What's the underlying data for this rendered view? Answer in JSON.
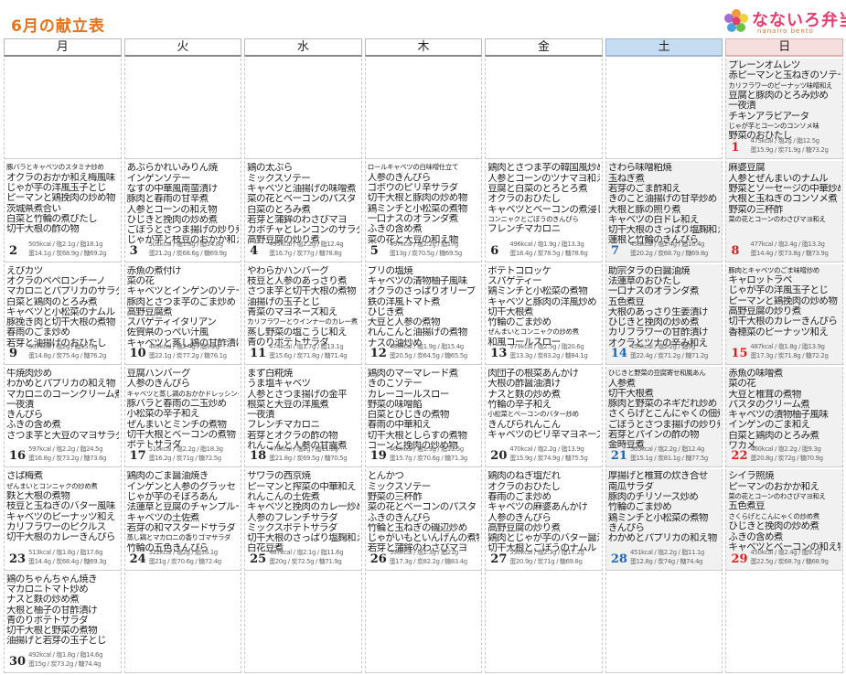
{
  "title": "6月の献立表",
  "logo": {
    "text": "なないろ弁当",
    "sub": "nanairo bento"
  },
  "weekdays": [
    "月",
    "火",
    "水",
    "木",
    "金",
    "土",
    "日"
  ],
  "calendar": [
    [
      null,
      null,
      null,
      null,
      null,
      null,
      {
        "day": "1",
        "menu": [
          "プレーンオムレツ",
          "赤ピーマンと玉ねぎのソテー",
          "カリフラワーのピーナッツ味噌和え",
          "豆腐と豚肉のとろみ炒め",
          "一夜漬",
          "チキンアラビアータ",
          "じゃが芋とコーンのコンソメ味",
          "野菜のおひたし"
        ],
        "nut1": "475kcal / 塩2g / 脂12.5g",
        "nut2": "蛋15.9g / 炭71.9g / 糖73.2g"
      }
    ],
    [
      {
        "day": "2",
        "menu": [
          "豚バラとキャベツのスタミナ炒め",
          "オクラのおかか和え梅風味",
          "じゃが芋の洋風玉子とじ",
          "ピーマンと鶏挽肉の炒め物",
          "茨城県煮合い",
          "白菜と竹輪の煮びたし",
          "切干大根の酢の物"
        ],
        "nut1": "505kcal / 塩2.1g / 脂18.1g",
        "nut2": "蛋14.1g / 炭68.9g / 糖69.2g"
      },
      {
        "day": "3",
        "menu": [
          "あぶらかれいみりん焼",
          "インゲンソテー",
          "なすの中華風南蛮漬け",
          "豚肉と春雨の甘辛煮",
          "人参とコーンの和え物",
          "ひじきと挽肉の炒め煮",
          "ごぼうとさつま揚げの炒り煮",
          "じゃが芋と枝豆のおかか和え"
        ],
        "nut1": "501kcal / 塩1.8g / 脂14.8g",
        "nut2": "蛋21.2g / 炭68.6g / 糖69.9g"
      },
      {
        "day": "4",
        "menu": [
          "鶏の太ぶら",
          "ミックスソテー",
          "キャベツと油揚げの味噌煮",
          "菜の花とベーコンのパスタ",
          "白菜のとろみ煮",
          "若芽と蒲鉾のわさびマヨ",
          "カボチャとレンコンのサラダ",
          "高野豆腐の炒り煮"
        ],
        "nut1": "495kcal / 塩2.2g / 脂12.4g",
        "nut2": "蛋16.7g / 炭77g / 糖78.8g"
      },
      {
        "day": "5",
        "menu": [
          "ロールキャベツの白味噌仕立て",
          "人参のきんぴら",
          "ゴボウのピリ辛サラダ",
          "切干大根と豚肉の炒め物",
          "鶏ミンチと小松菜の煮物",
          "一口ナスのオランダ煮",
          "ふきの含め煮",
          "菜の花と大豆の和え物"
        ],
        "nut1": "497kcal / 塩2.2g / 脂17g",
        "nut2": "蛋13g / 炭70.5g / 糖69.5g"
      },
      {
        "day": "6",
        "menu": [
          "鶏肉とさつま芋の韓国風炒め",
          "人参とコーンのツナマヨ和え",
          "豆腐と白菜のとろとろ煮",
          "オクラのおひたし",
          "キャベツとベーコンの煮浸し",
          "コンニャクとごぼうのきんぴら",
          "フレンチマカロニ"
        ],
        "nut1": "496kcal / 塩1.9g / 脂13.3g",
        "nut2": "蛋18.4g / 炭78.5g / 糖78.6g"
      },
      {
        "day": "7",
        "menu": [
          "さわら味噌粕焼",
          "玉ねぎ煮",
          "若芽のごま酢和え",
          "きのこと油揚げの甘辛炒め",
          "大根と豚の照り煮",
          "キャベツの白ドレ和え",
          "切干大根のさっぱり塩麹和え",
          "蓮根と竹輪のきんぴら"
        ],
        "nut1": "458kcal / 塩2.4g / 脂10.4g",
        "nut2": "蛋20.2g / 炭68.7g / 糖69.8g"
      },
      {
        "day": "8",
        "menu": [
          "麻婆豆腐",
          "人参とぜんまいのナムル",
          "野菜とソーセージの中華炒め",
          "大根と玉ねぎのコンソメ煮",
          "野菜の三杯酢",
          "菜の花とコーンのわさびマヨ和え"
        ],
        "nut1": "477kcal / 塩2.4g / 脂13.3g",
        "nut2": "蛋14.4g / 炭73.8g / 糖73.9g"
      }
    ],
    [
      {
        "day": "9",
        "menu": [
          "えびカツ",
          "オクラのペペロンチーノ",
          "マカロニとパプリカのサラダ",
          "白菜と鶏肉のとろみ煮",
          "キャベツと小松菜のナムル",
          "豚挽き肉と切干大根の煮物",
          "春雨のごま炒め",
          "若芽と油揚げのおひたし"
        ],
        "nut1": "507kcal / 塩2g / 脂15.3g",
        "nut2": "蛋14.8g / 炭75.4g / 糖76.2g"
      },
      {
        "day": "10",
        "menu": [
          "赤魚の煮付け",
          "菜の花",
          "キャベツとインゲンのソテー",
          "豚肉とさつま芋のごま炒め",
          "高野豆腐煮",
          "スパゲティイタリアン",
          "佐賀県のっぺい汁風",
          "キャベツと蒸し鶏の甘酢漬け"
        ],
        "nut1": "489kcal / 塩2.4g / 脂9.2g",
        "nut2": "蛋22.1g / 炭77.2g / 糖76.1g"
      },
      {
        "day": "11",
        "menu": [
          "やわらかハンバーグ",
          "枝豆と人参のあっさり煮",
          "さつま芋と切干大根の煮物",
          "油揚げの玉子とじ",
          "青菜のマヨネーズ和え",
          "カリフラワーとウインナーのカレー煮",
          "蒸し野菜の塩こうじ和え",
          "青のりポテトサラダ"
        ],
        "nut1": "474kcal / 塩1.7g / 脂13.1g",
        "nut2": "蛋15.6g / 炭71.8g / 糖71.4g"
      },
      {
        "day": "12",
        "menu": [
          "ブリの塩焼",
          "キャベツの清物柚子風味",
          "オクラのさっぱりオリーブ",
          "鉄の洋風トマト煮",
          "ひじき煮",
          "大豆と人参の煮物",
          "れんこんと油揚げの煮物",
          "ナスの油炒め"
        ],
        "nut1": "489kcal / 塩1.9g / 脂15.4g",
        "nut2": "蛋20.5g / 炭64.5g / 糖65.5g"
      },
      {
        "day": "13",
        "menu": [
          "ポテトコロッケ",
          "スパゲティー",
          "鶏ミンチと小松菜の煮物",
          "キャベツと豚肉の洋風炒め",
          "切干大根煮",
          "竹輪のごま炒め",
          "ぜんまいとコンニャクの炒め煮",
          "和風コールスロー"
        ],
        "nut1": "579kcal / 塩2.5g / 脂20.6g",
        "nut2": "蛋13.3g / 炭83.2g / 糖84.1g"
      },
      {
        "day": "14",
        "menu": [
          "助宗タラの白醤油焼",
          "法蓮草のおひたし",
          "一口ナスのオランダ煮",
          "五色煮豆",
          "大根のあっさり生姜漬け",
          "ひじきと挽肉の炒め煮",
          "カリフラワーの甘酢漬け",
          "オクラとツナの辛み和え"
        ],
        "nut1": "455kcal / 塩2.2g / 脂9g",
        "nut2": "蛋22.4g / 炭71.2g / 糖71.2g"
      },
      {
        "day": "15",
        "menu": [
          "豚肉とキャベツのごま味噌炒め",
          "キャロットラペ",
          "じゃが芋の洋風玉子とじ",
          "ピーマンと鶏挽肉の炒め物",
          "高野豆腐の炒り煮",
          "切干大根のカレーきんぴら",
          "香穂菜のピーナッツ和え"
        ],
        "nut1": "487kcal / 塩1.8g / 脂13.9g",
        "nut2": "蛋17.3g / 炭71.8g / 糖72.2g"
      }
    ],
    [
      {
        "day": "16",
        "menu": [
          "牛焼肉炒め",
          "わかめとパプリカの和え物",
          "マカロニのコーンクリーム煮",
          "一夜漬",
          "きんぴら",
          "ふきの含め煮",
          "さつま芋と大豆のマヨサラダ"
        ],
        "nut1": "597kcal / 塩2.2g / 脂24.5g",
        "nut2": "蛋16.8g / 炭73.2g / 糖73.6g"
      },
      {
        "day": "17",
        "menu": [
          "豆腐ハンバーグ",
          "人参のきんぴら",
          "キャベツと蒸し鶏のおかかドレッシング",
          "豚バラと春雨の二玉炒め",
          "小松菜の辛子和え",
          "ぜんまいとミンチの煮物",
          "切干大根とベーコンの煮物",
          "ポテトサラダ"
        ],
        "nut1": "510kcal / 塩2.2g / 脂18.3g",
        "nut2": "蛋16.2g / 炭71g / 糖72.5g"
      },
      {
        "day": "18",
        "menu": [
          "まず白糀焼",
          "うま塩キャベツ",
          "人参とさつま揚げの金平",
          "根菜と大豆の洋風煮",
          "一夜漬",
          "フレンチマカロニ",
          "若芽とオクラの酢の物",
          "れんこんと人参の甘露煮"
        ],
        "nut1": "478kcal / 塩2g / 脂11.2g",
        "nut2": "蛋21.8g / 炭69.5g / 糖70.5g"
      },
      {
        "day": "19",
        "menu": [
          "鶏肉のマーマレード煮",
          "きのこソテー",
          "カレーコールスロー",
          "野菜の味噌餡",
          "白菜とひじきの煮物",
          "春雨の中華和え",
          "切干大根としらすの煮物",
          "コーンと挽肉の炒め物"
        ],
        "nut1": "460kcal / 塩1.9g / 脂11.5g",
        "nut2": "蛋15.7g / 炭70.6g / 糖71.3g"
      },
      {
        "day": "20",
        "menu": [
          "肉団子の根菜あんかけ",
          "大根の酢醤油漬け",
          "ナスと麩の炒め煮",
          "竹輪の辛子和え",
          "小松菜とベーコンのバター炒め",
          "きんぴられんこん",
          "キャベツのピリ辛マヨネーズ"
        ],
        "nut1": "470kcal / 塩2.2g / 脂13.9g",
        "nut2": "蛋15.9g / 炭74.9g / 糖75.5g"
      },
      {
        "day": "21",
        "menu": [
          "ひじきと野菜の豆腐寄せ和風あん",
          "人参煮",
          "切干大根煮",
          "豚肉と野菜のネギだれ炒め",
          "さくらげとこんにゃくの佃煮",
          "ごぼうとさつま揚げの炒り煮",
          "若芽とパインの酢の物",
          "金時豆煮"
        ],
        "nut1": "505kcal / 塩2.2g / 脂12.4g",
        "nut2": "蛋15.1g / 炭81.1g / 糖77.5g"
      },
      {
        "day": "22",
        "menu": [
          "赤魚の味噌煮",
          "菜の花",
          "大豆と椎茸の煮物",
          "パスタのクリーム煮",
          "キャベツの漬物柚子風味",
          "インゲンのごま和え",
          "白菜と鶏肉のとろみ煮",
          "ワカメ"
        ],
        "nut1": "460kcal / 塩2.2g / 脂9.3g",
        "nut2": "蛋20.8g / 炭72g / 糖70.9g"
      }
    ],
    [
      {
        "day": "23",
        "menu": [
          "さば梅煮",
          "ぜんまいとコンニャクの炒め煮",
          "麩と大根の煮物",
          "枝豆と玉ねぎのバター風味",
          "キャベツのピーナッツ和え",
          "カリフラワーのピクルス",
          "切干大根のカレーきんぴら"
        ],
        "nut1": "513kcal / 塩1.8g / 脂17.6g",
        "nut2": "蛋14.4g / 炭68.4g / 糖69.3g"
      },
      {
        "day": "24",
        "menu": [
          "鶏肉のごま醤油焼き",
          "インゲンと人参のグラッセ",
          "じゃが芋のそぼろあん",
          "法蓮草と豆腐のチャンプルー",
          "キャベツの土佐煮",
          "若芽の和マスタードサラダ",
          "蒸し鶏とマカロニの香りゴマサラダ",
          "竹輪の五色きんぴら"
        ],
        "nut1": "522kcal / 塩2g / 脂16.1g",
        "nut2": "蛋21g / 炭70.6g / 糖72.4g"
      },
      {
        "day": "25",
        "menu": [
          "サワラの西京焼",
          "ピーマンと搾菜の中華和え",
          "れんこんの土佐煮",
          "キャベツと挽肉のカレー炒め",
          "人参のフレンチサラダ",
          "ミックスポテトサラダ",
          "切干大根のさっぱり塩麹和え",
          "白花豆煮"
        ],
        "nut1": "487kcal / 塩2.1g / 脂11.6g",
        "nut2": "蛋20g / 炭72.5g / 糖71.9g"
      },
      {
        "day": "26",
        "menu": [
          "とんかつ",
          "ミックスソテー",
          "野菜の三杯酢",
          "菜の花とベーコンのパスタ",
          "ふきのきんぴら",
          "竹輪と玉ねぎの磯辺炒め",
          "じゃがいもといんげんの煮物",
          "若芽と蒲鉾のわさびマヨ"
        ],
        "nut1": "598kcal / 塩2.3g / 脂21g",
        "nut2": "蛋17.3g / 炭82.2g / 糖83.4g"
      },
      {
        "day": "27",
        "menu": [
          "鶏肉のねぎ塩だれ",
          "オクラのおひたし",
          "春雨のごま炒め",
          "キャベツの麻婆あんかけ",
          "人参のきんぴら",
          "高野豆腐の炒り煮",
          "鶏肉とじゃが芋のバター醤油",
          "切干大根とごぼうのナムル"
        ],
        "nut1": "530kcal / 塩2.3g / 脂17.2g",
        "nut2": "蛋20.9g / 炭71g / 糖69.8g"
      },
      {
        "day": "28",
        "menu": [
          "厚揚げと椎茸の炊き合せ",
          "南瓜サラダ",
          "豚肉のチリソース炒め",
          "竹輪のごま炒め",
          "鶏ミンチと小松菜の煮物",
          "きんぴら",
          "わかめとパプリカの和え物"
        ],
        "nut1": "451kcal / 塩2.2g / 脂11.1g",
        "nut2": "蛋12.8g / 炭74g / 糖74.4g"
      },
      {
        "day": "29",
        "menu": [
          "シイラ照焼",
          "ピーマンのおかか和え",
          "菜の花とコーンのわさびマヨ和え",
          "五色煮豆",
          "さくらげとこんにゃくの炒め煮",
          "ひじきと挽肉の炒め煮",
          "ふきの含め煮",
          "キャベツとベーコンの和え物"
        ],
        "nut1": "450kcal / 塩2.4g / 脂9.1g",
        "nut2": "蛋22.5g / 炭68.7g / 糖68.9g"
      }
    ],
    [
      {
        "day": "30",
        "menu": [
          "鶏のちゃんちゃん焼き",
          "マカロニトマト炒め",
          "ナスと麩の炒め煮",
          "大根と柚子の甘酢漬け",
          "青のりポテトサラダ",
          "切干大根と野菜の煮物",
          "油揚げと若芽の玉子とじ"
        ],
        "nut1": "492kcal / 塩1.8g / 脂14.6g",
        "nut2": "蛋15g / 炭73.2g / 糖74.4g"
      },
      null,
      null,
      null,
      null,
      null,
      null
    ]
  ]
}
